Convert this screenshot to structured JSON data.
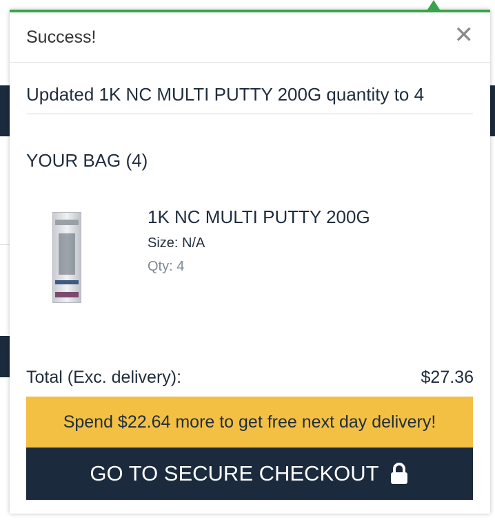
{
  "popup": {
    "title": "Success!",
    "close_icon": "close-icon",
    "message": "Updated 1K NC MULTI PUTTY 200G quantity to 4"
  },
  "bag": {
    "title": "YOUR BAG (4)",
    "items": [
      {
        "name": "1K NC MULTI PUTTY 200G",
        "size": "Size: N/A",
        "qty": "Qty: 4"
      }
    ]
  },
  "summary": {
    "total_label": "Total (Exc. delivery):",
    "total_value": "$27.36",
    "promo_text": "Spend $22.64 more to get free next day delivery!"
  },
  "actions": {
    "checkout_label": "GO TO SECURE CHECKOUT",
    "checkout_icon": "lock-icon"
  },
  "colors": {
    "accent_green": "#3aa34a",
    "navy": "#1b2a3d",
    "promo_yellow": "#f4c043"
  }
}
